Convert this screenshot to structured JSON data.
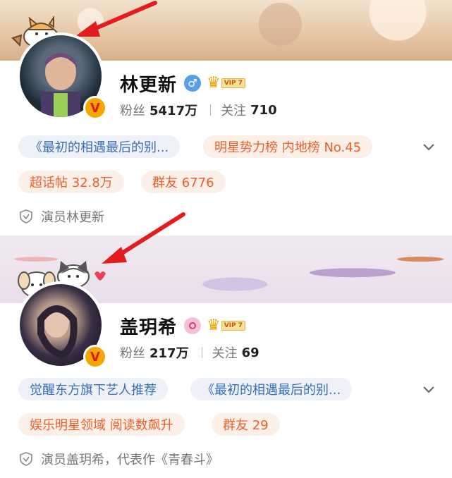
{
  "cards": [
    {
      "name": "林更新",
      "gender": "male",
      "vip_label": "VIP 7",
      "followers_label": "粉丝",
      "followers_value": "5417万",
      "following_label": "关注",
      "following_value": "710",
      "tags_row1": [
        "《最初的相遇最后的别...",
        "明星势力榜 内地榜 No.45"
      ],
      "tags_row2": [
        "超话帖 32.8万",
        "群友 6776"
      ],
      "bio": "演员林更新"
    },
    {
      "name": "盖玥希",
      "gender": "female",
      "vip_label": "VIP 7",
      "followers_label": "粉丝",
      "followers_value": "217万",
      "following_label": "关注",
      "following_value": "69",
      "tags_row1": [
        "觉醒东方旗下艺人推荐",
        "《最初的相遇最后的别..."
      ],
      "tags_row2": [
        "娱乐明星领域 阅读数飙升",
        "群友 29"
      ],
      "bio": "演员盖玥希，代表作《青春斗》"
    }
  ],
  "icons": {
    "verified_badge": "V",
    "crown": "♛",
    "male_symbol": "♂"
  },
  "colors": {
    "accent_blue": "#3a6fb6",
    "accent_orange": "#e8612c",
    "arrow_red": "#e31d1d",
    "verified_gold": "#f4a700"
  }
}
